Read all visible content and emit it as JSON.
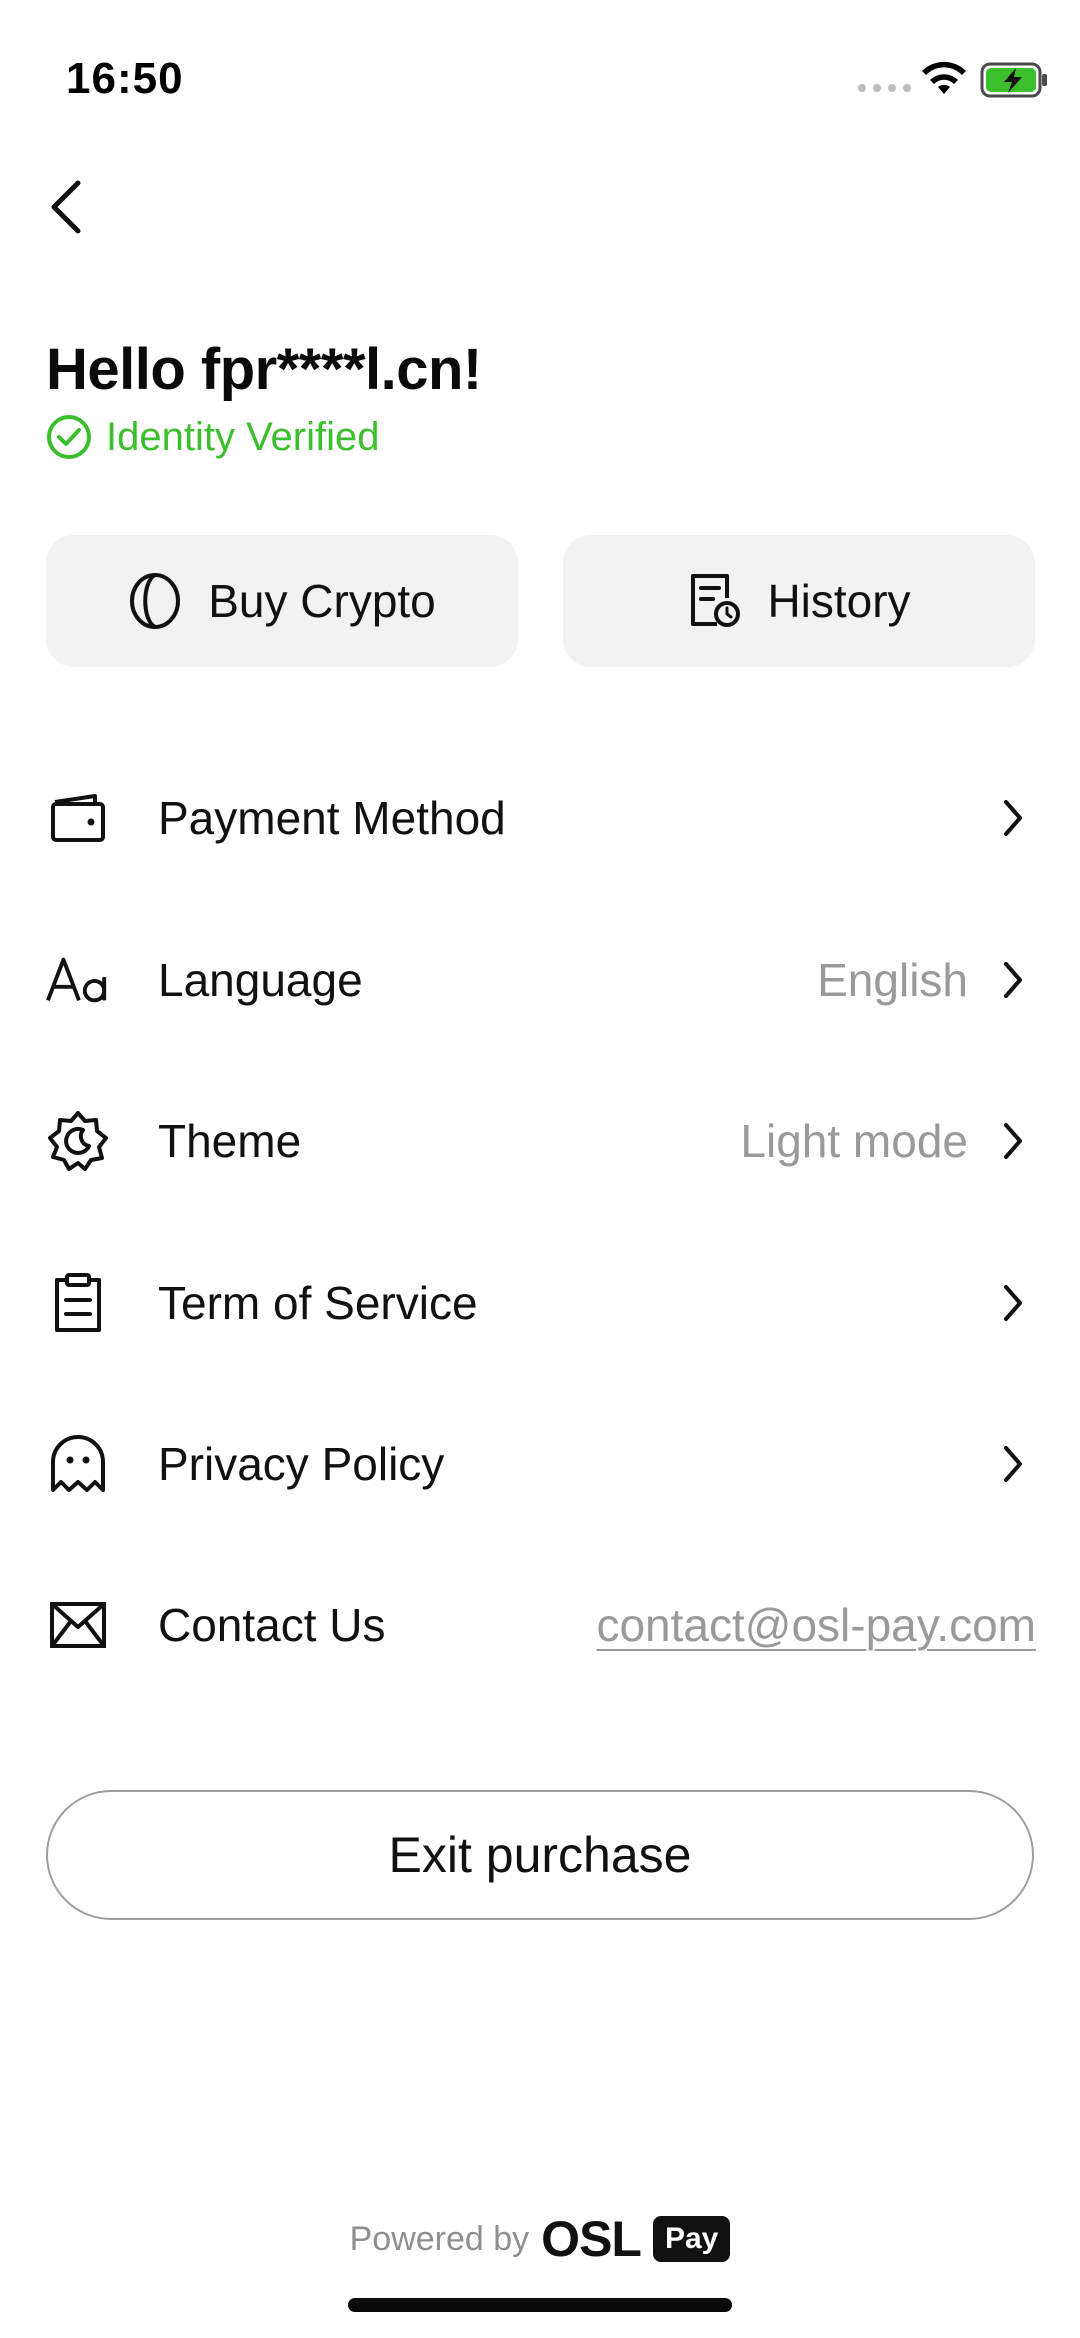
{
  "status_bar": {
    "time": "16:50"
  },
  "header": {
    "greeting": "Hello fpr****l.cn!",
    "verified_label": "Identity Verified"
  },
  "actions": {
    "buy_crypto_label": "Buy Crypto",
    "history_label": "History"
  },
  "menu": {
    "items": [
      {
        "label": "Payment Method",
        "value": "",
        "icon": "wallet-icon"
      },
      {
        "label": "Language",
        "value": "English",
        "icon": "font-icon"
      },
      {
        "label": "Theme",
        "value": "Light mode",
        "icon": "theme-icon"
      },
      {
        "label": "Term of Service",
        "value": "",
        "icon": "clipboard-icon"
      },
      {
        "label": "Privacy Policy",
        "value": "",
        "icon": "ghost-icon"
      },
      {
        "label": "Contact Us",
        "value": "contact@osl-pay.com",
        "icon": "mail-icon"
      }
    ]
  },
  "exit_button_label": "Exit purchase",
  "footer": {
    "powered_by": "Powered by",
    "brand": "OSL",
    "badge": "Pay"
  },
  "colors": {
    "accent_green": "#3cbf2d",
    "muted_text": "#9a9a9a",
    "button_bg": "#f2f2f2"
  }
}
